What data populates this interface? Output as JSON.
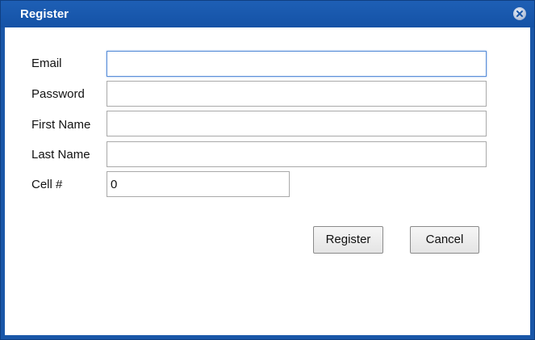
{
  "dialog": {
    "title": "Register",
    "close_icon": "close-icon"
  },
  "form": {
    "email": {
      "label": "Email",
      "value": ""
    },
    "password": {
      "label": "Password",
      "value": ""
    },
    "first_name": {
      "label": "First Name",
      "value": ""
    },
    "last_name": {
      "label": "Last Name",
      "value": ""
    },
    "cell": {
      "label": "Cell #",
      "value": "0"
    }
  },
  "actions": {
    "register_label": "Register",
    "cancel_label": "Cancel"
  },
  "colors": {
    "titlebar": "#1452a6",
    "border": "#1a57a8"
  }
}
